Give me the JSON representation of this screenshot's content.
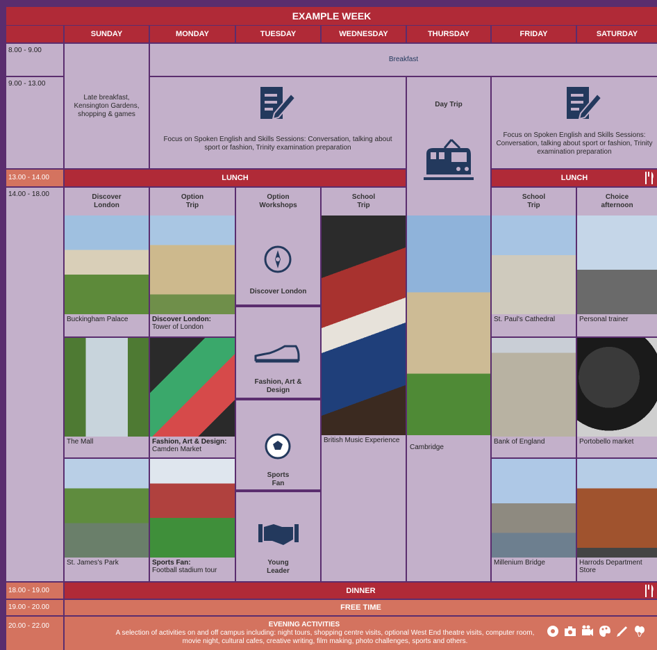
{
  "title": "EXAMPLE WEEK",
  "days": [
    "SUNDAY",
    "MONDAY",
    "TUESDAY",
    "WEDNESDAY",
    "THURSDAY",
    "FRIDAY",
    "SATURDAY"
  ],
  "times": [
    "8.00 - 9.00",
    "9.00 - 13.00",
    "13.00 - 14.00",
    "14.00 - 18.00",
    "18.00 - 19.00",
    "19.00 - 20.00",
    "20.00 - 22.00"
  ],
  "breakfast": "Breakfast",
  "sunday_morning": "Late breakfast, Kensington Gardens, shopping & games",
  "focus_mon_wed": "Focus on Spoken English and Skills Sessions: Conversation, talking about sport or fashion, Trinity examination preparation",
  "focus_fri_sat": "Focus on Spoken English and Skills Sessions: Conversation, talking about sport or fashion, Trinity examination preparation",
  "day_trip": "Day Trip",
  "lunch": "LUNCH",
  "col_heads": {
    "sunday": "Discover London",
    "monday": "Option Trip",
    "tuesday": "Option Workshops",
    "wednesday": "School Trip",
    "friday": "School Trip",
    "saturday": "Choice afternoon"
  },
  "sunday_photos": [
    "Buckingham Palace",
    "The Mall",
    "St. James's Park"
  ],
  "monday_photos": [
    {
      "bold": "Discover London:",
      "text": "Tower of London"
    },
    {
      "bold": "Fashion, Art & Design:",
      "text": "Camden Market"
    },
    {
      "bold": "Sports Fan:",
      "text": "Football stadium tour"
    }
  ],
  "workshops": [
    "Discover London",
    "Fashion, Art & Design",
    "Sports Fan",
    "Young Leader"
  ],
  "wednesday_caption": "British Music Experience",
  "thursday_caption": "Cambridge",
  "friday_photos": [
    "St. Paul's Cathedral",
    "Bank of England",
    "Millenium Bridge"
  ],
  "saturday_photos": [
    "Personal trainer",
    "Portobello market",
    "Harrods Department Store"
  ],
  "dinner": "DINNER",
  "free_time": "FREE TIME",
  "evening_title": "EVENING ACTIVITIES",
  "evening_text": "A selection of activities on and off campus including: night tours, shopping centre visits, optional West End theatre visits, computer room, movie night, cultural cafes, creative writing, film making, photo challenges, sports and others.",
  "colors": {
    "red": "#b02a37",
    "salmon": "#d4735f",
    "lilac": "#c3b0ca",
    "border": "#5a2d6e",
    "navy": "#23395d"
  }
}
